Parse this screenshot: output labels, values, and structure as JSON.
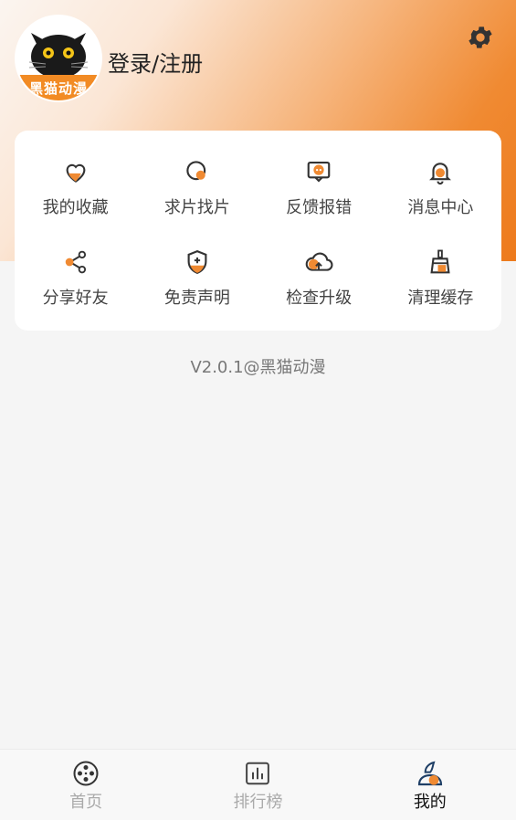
{
  "header": {
    "login_label": "登录/注册",
    "avatar_caption": "黑猫动漫",
    "accent_color": "#f08a32"
  },
  "menu": [
    {
      "label": "我的收藏",
      "icon": "heart-icon"
    },
    {
      "label": "求片找片",
      "icon": "search-film-icon"
    },
    {
      "label": "反馈报错",
      "icon": "feedback-icon"
    },
    {
      "label": "消息中心",
      "icon": "bell-icon"
    },
    {
      "label": "分享好友",
      "icon": "share-icon"
    },
    {
      "label": "免责声明",
      "icon": "shield-icon"
    },
    {
      "label": "检查升级",
      "icon": "cloud-upload-icon"
    },
    {
      "label": "清理缓存",
      "icon": "broom-icon"
    }
  ],
  "version": "V2.0.1@黑猫动漫",
  "tabs": [
    {
      "label": "首页",
      "icon": "film-reel-icon",
      "active": false
    },
    {
      "label": "排行榜",
      "icon": "chart-icon",
      "active": false
    },
    {
      "label": "我的",
      "icon": "profile-icon",
      "active": true
    }
  ]
}
